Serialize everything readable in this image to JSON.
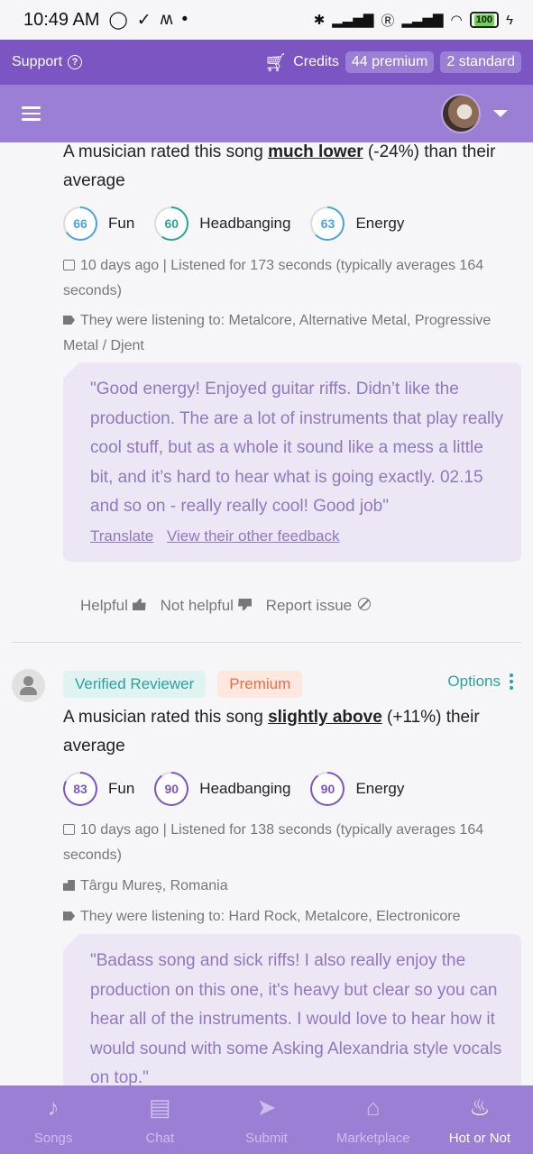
{
  "status_bar": {
    "time": "10:49 AM",
    "battery": "100"
  },
  "top_bar": {
    "support_label": "Support",
    "credits_label": "Credits",
    "premium_credits": "44 premium",
    "standard_credits": "2 standard"
  },
  "reviews": [
    {
      "headline_prefix": "A musician rated this song ",
      "headline_emphasis": "much lower",
      "headline_suffix": " (-24%) than their average",
      "scores": [
        {
          "value": "66",
          "label": "Fun",
          "fraction": 0.66
        },
        {
          "value": "60",
          "label": "Headbanging",
          "fraction": 0.6
        },
        {
          "value": "63",
          "label": "Energy",
          "fraction": 0.63
        }
      ],
      "date": "10 days ago",
      "listen": "| Listened for 173 seconds (typically averages 164 seconds)",
      "genres": "They were listening to: Metalcore, Alternative Metal, Progressive Metal / Djent",
      "quote": "\"Good energy! Enjoyed guitar riffs. Didn’t like the production. The are a lot of instruments that play really cool stuff, but as a whole it sound like a mess a little bit, and it’s hard to hear what is going exactly. 02.15 and so on - really really cool! Good job\"",
      "translate_label": "Translate",
      "other_feedback_label": "View their other feedback",
      "helpful_label": "Helpful",
      "not_helpful_label": "Not helpful",
      "report_label": "Report issue"
    },
    {
      "badge_verified": "Verified Reviewer",
      "badge_premium": "Premium",
      "options_label": "Options",
      "headline_prefix": "A musician rated this song ",
      "headline_emphasis": "slightly above",
      "headline_suffix": " (+11%) their average",
      "scores": [
        {
          "value": "83",
          "label": "Fun",
          "fraction": 0.83
        },
        {
          "value": "90",
          "label": "Headbanging",
          "fraction": 0.9
        },
        {
          "value": "90",
          "label": "Energy",
          "fraction": 0.9
        }
      ],
      "date": "10 days ago",
      "listen": "| Listened for 138 seconds (typically averages 164 seconds)",
      "location": "Târgu Mureș, Romania",
      "genres": "They were listening to: Hard Rock, Metalcore, Electronicore",
      "quote": "\"Badass song and sick riffs! I also really enjoy the production on this one, it's heavy but clear so you can hear all of the instruments. I would love to hear how it would sound with some Asking Alexandria style vocals on top.\""
    }
  ],
  "bottom_nav": [
    {
      "label": "Songs",
      "icon": "music-note-icon"
    },
    {
      "label": "Chat",
      "icon": "chat-icon"
    },
    {
      "label": "Submit",
      "icon": "send-icon"
    },
    {
      "label": "Marketplace",
      "icon": "store-icon"
    },
    {
      "label": "Hot or Not",
      "icon": "flame-icon",
      "active": true
    }
  ],
  "colors": {
    "primary": "#7b55c2",
    "primary_light": "#9b7fd4",
    "accent_teal": "#2aa39a",
    "premium_orange": "#ee6c47",
    "quote_bg": "#ece6f5"
  }
}
